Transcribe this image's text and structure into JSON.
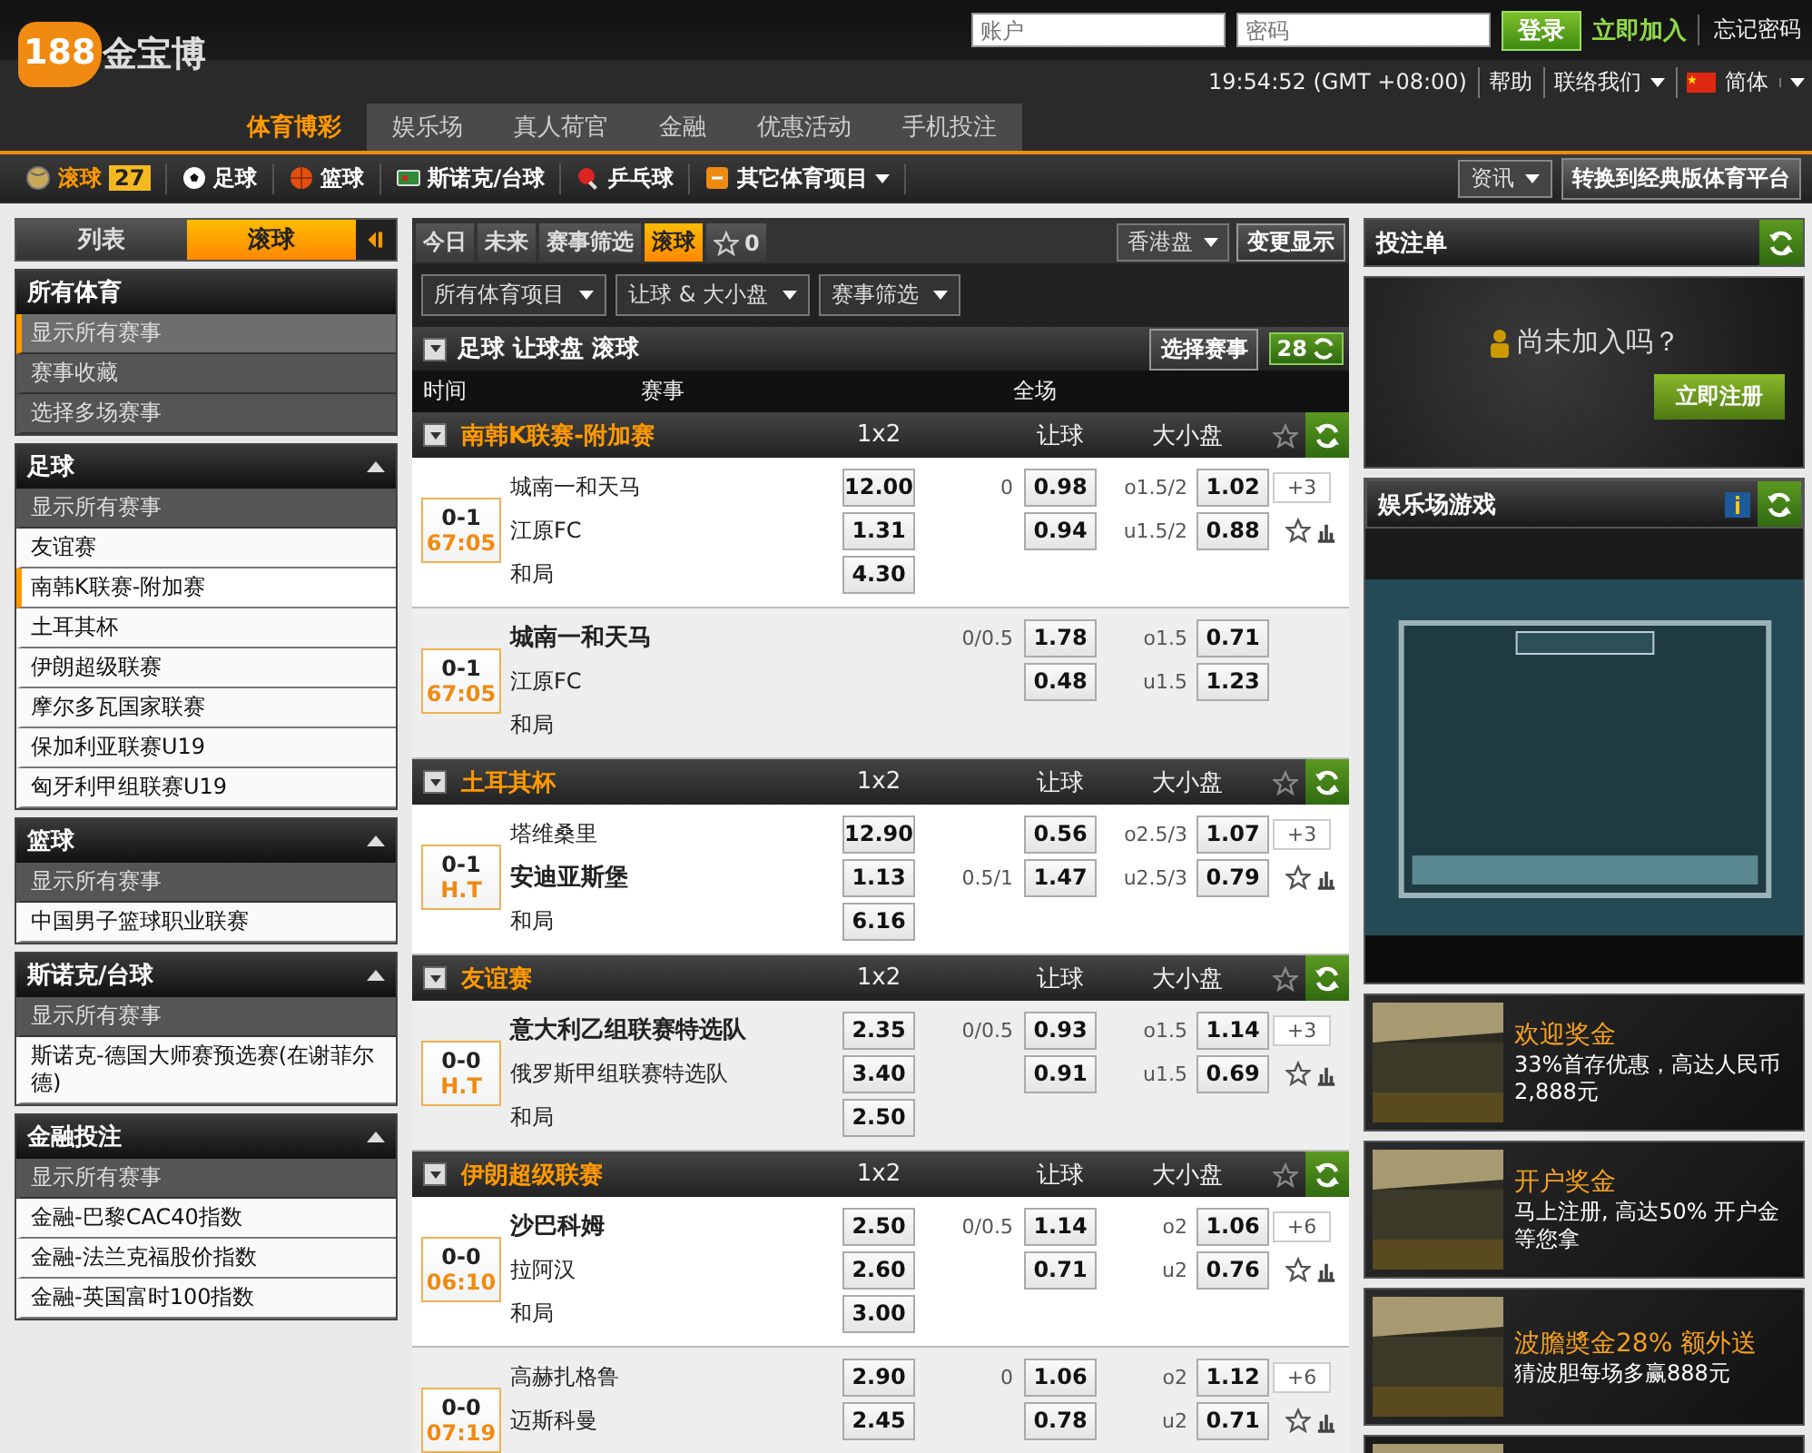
{
  "header": {
    "logo": {
      "number": "188",
      "name": "金宝博"
    },
    "login": {
      "account_placeholder": "账户",
      "password_placeholder": "密码",
      "login_button": "登录",
      "join_link": "立即加入",
      "forgot_link": "忘记密码"
    },
    "clock": "19:54:52 (GMT +08:00)",
    "links": [
      {
        "label": "帮助",
        "dropdown": false
      },
      {
        "label": "联络我们",
        "dropdown": true
      }
    ],
    "language": "简体"
  },
  "main_nav": [
    {
      "label": "体育博彩",
      "selected": true
    },
    {
      "label": "娱乐场",
      "selected": false
    },
    {
      "label": "真人荷官",
      "selected": false
    },
    {
      "label": "金融",
      "selected": false
    },
    {
      "label": "优惠活动",
      "selected": false
    },
    {
      "label": "手机投注",
      "selected": false
    }
  ],
  "sports_bar": {
    "items": [
      {
        "kind": "live",
        "label": "滚球",
        "count": "27",
        "dropdown": false
      },
      {
        "kind": "football",
        "label": "足球",
        "dropdown": false
      },
      {
        "kind": "basketball",
        "label": "篮球",
        "dropdown": false
      },
      {
        "kind": "snooker",
        "label": "斯诺克/台球",
        "dropdown": false
      },
      {
        "kind": "tabletennis",
        "label": "乒乓球",
        "dropdown": false
      },
      {
        "kind": "other",
        "label": "其它体育项目",
        "dropdown": true
      }
    ],
    "news": "资讯",
    "classic_button": "转换到经典版体育平台"
  },
  "sidebar": {
    "tabs": [
      {
        "label": "列表",
        "selected": false
      },
      {
        "label": "滚球",
        "selected": true
      }
    ],
    "groups": [
      {
        "title": "所有体育",
        "collapsible": false,
        "items": [
          {
            "label": "显示所有赛事",
            "kind": "dark",
            "selected": true
          },
          {
            "label": "赛事收藏",
            "kind": "dark",
            "selected": false
          },
          {
            "label": "选择多场赛事",
            "kind": "dark",
            "selected": false
          }
        ]
      },
      {
        "title": "足球",
        "collapsible": true,
        "items": [
          {
            "label": "显示所有赛事",
            "kind": "dark",
            "selected": false
          },
          {
            "label": "友谊赛",
            "kind": "light",
            "selected": false
          },
          {
            "label": "南韩K联赛-附加赛",
            "kind": "light",
            "selected": true
          },
          {
            "label": "土耳其杯",
            "kind": "light",
            "selected": false
          },
          {
            "label": "伊朗超级联赛",
            "kind": "light",
            "selected": false
          },
          {
            "label": "摩尔多瓦国家联赛",
            "kind": "light",
            "selected": false
          },
          {
            "label": "保加利亚联赛U19",
            "kind": "light",
            "selected": false
          },
          {
            "label": "匈牙利甲组联赛U19",
            "kind": "light",
            "selected": false
          }
        ]
      },
      {
        "title": "篮球",
        "collapsible": true,
        "items": [
          {
            "label": "显示所有赛事",
            "kind": "dark",
            "selected": false
          },
          {
            "label": "中国男子篮球职业联赛",
            "kind": "light",
            "selected": false
          }
        ]
      },
      {
        "title": "斯诺克/台球",
        "collapsible": true,
        "items": [
          {
            "label": "显示所有赛事",
            "kind": "dark",
            "selected": false
          },
          {
            "label": "斯诺克-德国大师赛预选赛(在谢菲尔德)",
            "kind": "light",
            "selected": false
          }
        ]
      },
      {
        "title": "金融投注",
        "collapsible": true,
        "items": [
          {
            "label": "显示所有赛事",
            "kind": "dark",
            "selected": false
          },
          {
            "label": "金融-巴黎CAC40指数",
            "kind": "light",
            "selected": false
          },
          {
            "label": "金融-法兰克福股价指数",
            "kind": "light",
            "selected": false
          },
          {
            "label": "金融-英国富时100指数",
            "kind": "light",
            "selected": false
          }
        ]
      }
    ]
  },
  "center": {
    "tabs": [
      {
        "label": "今日",
        "selected": false
      },
      {
        "label": "未来",
        "selected": false
      },
      {
        "label": "赛事筛选",
        "selected": false
      },
      {
        "label": "滚球",
        "selected": true
      }
    ],
    "favorites": {
      "count": "0"
    },
    "odds_format": "香港盘",
    "change_display": "变更显示",
    "filters": [
      "所有体育项目",
      "让球 & 大小盘",
      "赛事筛选"
    ],
    "section": {
      "title": "足球 让球盘 滚球",
      "select_button": "选择赛事",
      "count": "28"
    },
    "columns": [
      "时间",
      "赛事",
      "全场"
    ],
    "leagues": [
      {
        "name": "南韩K联赛-附加赛",
        "markets": [
          "1x2",
          "让球",
          "大小盘"
        ],
        "matches": [
          {
            "score": "0-1",
            "clock": "67:05",
            "shaded": false,
            "more": "+3",
            "lines": [
              {
                "team": "城南一和天马",
                "bold": false,
                "x12": "12.00",
                "hdp_line": "0",
                "hdp": "0.98",
                "ou_line": "o1.5/2",
                "ou": "1.02"
              },
              {
                "team": "江原FC",
                "bold": false,
                "x12": "1.31",
                "hdp": "0.94",
                "ou_line": "u1.5/2",
                "ou": "0.88"
              },
              {
                "team": "和局",
                "bold": false,
                "x12": "4.30"
              }
            ]
          },
          {
            "score": "0-1",
            "clock": "67:05",
            "shaded": true,
            "lines": [
              {
                "team": "城南一和天马",
                "bold": true,
                "hdp_line": "0/0.5",
                "hdp": "1.78",
                "ou_line": "o1.5",
                "ou": "0.71"
              },
              {
                "team": "江原FC",
                "bold": false,
                "hdp": "0.48",
                "ou_line": "u1.5",
                "ou": "1.23"
              },
              {
                "team": "和局",
                "bold": false
              }
            ]
          }
        ]
      },
      {
        "name": "土耳其杯",
        "markets": [
          "1x2",
          "让球",
          "大小盘"
        ],
        "matches": [
          {
            "score": "0-1",
            "clock": "H.T",
            "shaded": false,
            "more": "+3",
            "lines": [
              {
                "team": "塔维桑里",
                "bold": false,
                "x12": "12.90",
                "hdp": "0.56",
                "ou_line": "o2.5/3",
                "ou": "1.07"
              },
              {
                "team": "安迪亚斯堡",
                "bold": true,
                "x12": "1.13",
                "hdp_line": "0.5/1",
                "hdp": "1.47",
                "ou_line": "u2.5/3",
                "ou": "0.79"
              },
              {
                "team": "和局",
                "bold": false,
                "x12": "6.16"
              }
            ]
          }
        ]
      },
      {
        "name": "友谊赛",
        "markets": [
          "1x2",
          "让球",
          "大小盘"
        ],
        "matches": [
          {
            "score": "0-0",
            "clock": "H.T",
            "shaded": true,
            "more": "+3",
            "lines": [
              {
                "team": "意大利乙组联赛特选队",
                "bold": true,
                "x12": "2.35",
                "hdp_line": "0/0.5",
                "hdp": "0.93",
                "ou_line": "o1.5",
                "ou": "1.14"
              },
              {
                "team": "俄罗斯甲组联赛特选队",
                "bold": false,
                "x12": "3.40",
                "hdp": "0.91",
                "ou_line": "u1.5",
                "ou": "0.69"
              },
              {
                "team": "和局",
                "bold": false,
                "x12": "2.50"
              }
            ]
          }
        ]
      },
      {
        "name": "伊朗超级联赛",
        "markets": [
          "1x2",
          "让球",
          "大小盘"
        ],
        "matches": [
          {
            "score": "0-0",
            "clock": "06:10",
            "shaded": false,
            "more": "+6",
            "lines": [
              {
                "team": "沙巴科姆",
                "bold": true,
                "x12": "2.50",
                "hdp_line": "0/0.5",
                "hdp": "1.14",
                "ou_line": "o2",
                "ou": "1.06"
              },
              {
                "team": "拉阿汉",
                "bold": false,
                "x12": "2.60",
                "hdp": "0.71",
                "ou_line": "u2",
                "ou": "0.76"
              },
              {
                "team": "和局",
                "bold": false,
                "x12": "3.00"
              }
            ]
          },
          {
            "score": "0-0",
            "clock": "07:19",
            "shaded": true,
            "more": "+6",
            "lines": [
              {
                "team": "高赫扎格鲁",
                "bold": false,
                "x12": "2.90",
                "hdp_line": "0",
                "hdp": "1.06",
                "ou_line": "o2",
                "ou": "1.12"
              },
              {
                "team": "迈斯科曼",
                "bold": false,
                "x12": "2.45",
                "hdp": "0.78",
                "ou_line": "u2",
                "ou": "0.71"
              }
            ]
          }
        ]
      }
    ]
  },
  "right": {
    "betslip": {
      "title": "投注单",
      "prompt": "尚未加入吗？",
      "register_button": "立即注册"
    },
    "casino": {
      "title": "娱乐场游戏"
    },
    "promos": [
      {
        "title": "欢迎奖金",
        "text": "33%首存优惠，高达人民币 2,888元"
      },
      {
        "title": "开户奖金",
        "text": "马上注册, 高达50% 开户金等您拿"
      },
      {
        "title": "波膽奬金28% 额外送",
        "text": "猜波胆每场多赢888元"
      }
    ]
  }
}
